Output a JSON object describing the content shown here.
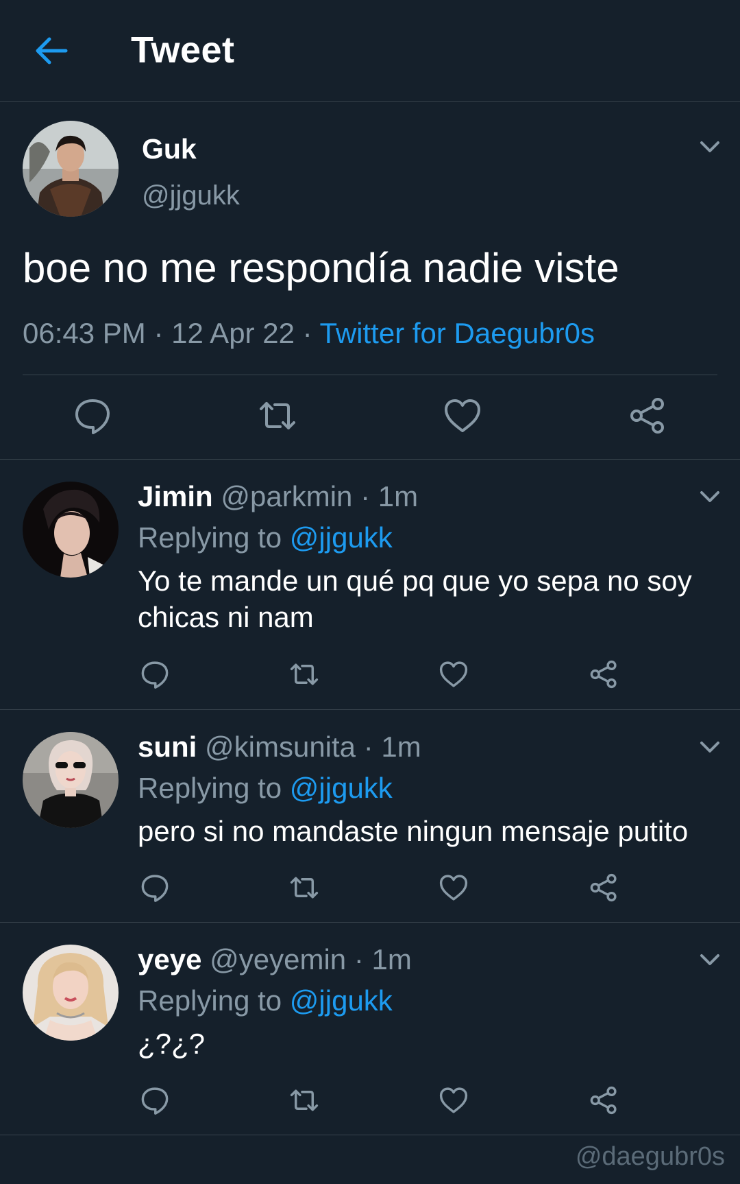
{
  "header": {
    "title": "Tweet"
  },
  "main_tweet": {
    "name": "Guk",
    "handle": "@jjgukk",
    "text": "boe no me respondía nadie viste",
    "time": "06:43 PM",
    "date": "12 Apr 22",
    "source": "Twitter for Daegubr0s",
    "separator": " · "
  },
  "replies": [
    {
      "name": "Jimin",
      "handle": "@parkmin",
      "time": "1m",
      "replying_label": "Replying to",
      "mention": "@jjgukk",
      "text": "Yo te mande un qué pq que yo sepa no soy chicas ni nam"
    },
    {
      "name": "suni",
      "handle": "@kimsunita",
      "time": "1m",
      "replying_label": "Replying to",
      "mention": "@jjgukk",
      "text": "pero si no mandaste ningun mensaje putito"
    },
    {
      "name": "yeye",
      "handle": "@yeyemin",
      "time": "1m",
      "replying_label": "Replying to",
      "mention": "@jjgukk",
      "text": "¿?¿?"
    }
  ],
  "dot": "·",
  "watermark": "@daegubr0s",
  "icons": {
    "back": "arrow-left-icon",
    "caret": "chevron-down-icon",
    "reply": "speech-bubble-icon",
    "retweet": "retweet-icon",
    "like": "heart-icon",
    "share": "share-icon"
  },
  "colors": {
    "background": "#15202b",
    "accent": "#1d9bf0",
    "secondary_text": "#8899a6",
    "divider": "#38444d"
  }
}
